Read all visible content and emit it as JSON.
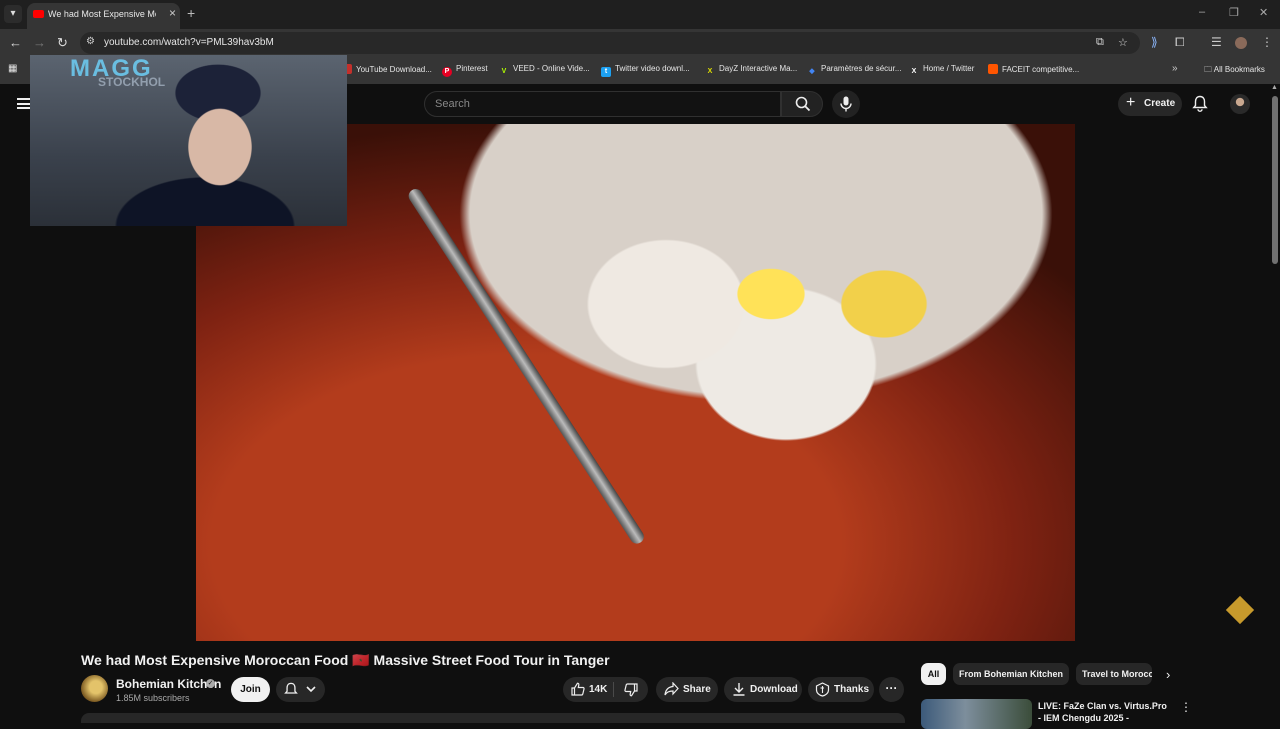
{
  "browser": {
    "tab_title": "We had Most Expensive Moroc",
    "url": "youtube.com/watch?v=PML39hav3bM",
    "bookmarks": [
      {
        "label": "YouTube Download...",
        "icon": "download-icon",
        "color": "#c4302b"
      },
      {
        "label": "Pinterest",
        "icon": "pinterest-icon",
        "color": "#e60023"
      },
      {
        "label": "VEED - Online Vide...",
        "icon": "veed-icon",
        "color": "#b3ff00"
      },
      {
        "label": "Twitter video downl...",
        "icon": "twitter-download-icon",
        "color": "#1da1f2"
      },
      {
        "label": "DayZ Interactive Ma...",
        "icon": "x-icon",
        "color": "#cfcfcf"
      },
      {
        "label": "Paramètres de sécur...",
        "icon": "settings-icon",
        "color": "#4285f4"
      },
      {
        "label": "Home / Twitter",
        "icon": "x-icon",
        "color": "#e7e9ea"
      },
      {
        "label": "FACEIT competitive...",
        "icon": "faceit-icon",
        "color": "#ff5500"
      }
    ],
    "all_bookmarks": "All Bookmarks"
  },
  "youtube": {
    "search_placeholder": "Search",
    "create_label": "Create",
    "video": {
      "title": "We had Most Expensive Moroccan Food 🇲🇦 Massive Street Food Tour in Tanger",
      "channel": "Bohemian Kitchen",
      "subscribers": "1.85M subscribers",
      "join_label": "Join",
      "likes": "14K",
      "share_label": "Share",
      "download_label": "Download",
      "thanks_label": "Thanks"
    },
    "chips": [
      "All",
      "From Bohemian Kitchen",
      "Travel to Morocco"
    ],
    "recommendation": {
      "title": "LIVE: FaZe Clan vs. Virtus.Pro - IEM Chengdu 2025 -"
    },
    "webcam_overlay": {
      "logo_text": "MAGG",
      "sub_text": "STOCKHOL"
    }
  },
  "colors": {
    "yt_background": "#0f0f0f",
    "chrome_toolbar": "#353535",
    "youtube_red": "#ff0000"
  }
}
